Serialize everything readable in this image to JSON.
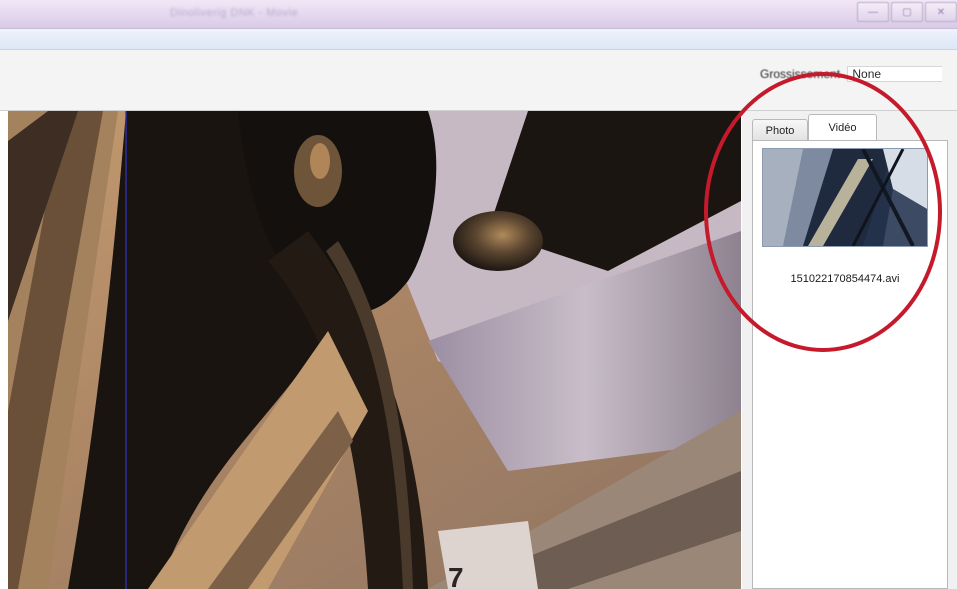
{
  "window": {
    "title": "Dinoliverig DNK - Movie",
    "buttons": {
      "minimize": "—",
      "maximize": "▢",
      "close": "✕"
    }
  },
  "toolbar": {
    "zoom_label": "Grossissement",
    "zoom_value": "None"
  },
  "side_panel": {
    "tabs": [
      {
        "label": "Photo",
        "active": false
      },
      {
        "label": "Vidéo",
        "active": true
      }
    ],
    "videos": [
      {
        "filename": "151022170854474.avi"
      }
    ]
  },
  "annotation": {
    "ring_color": "#c41a2b"
  },
  "viewer": {
    "overlay_text": "7"
  }
}
